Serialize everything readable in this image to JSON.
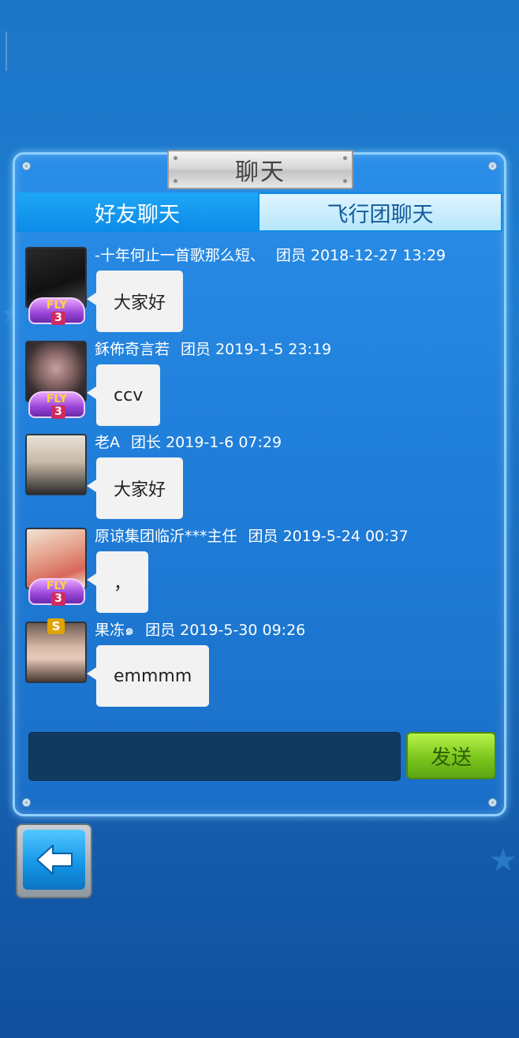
{
  "title": "聊天",
  "tabs": [
    {
      "label": "好友聊天",
      "active": false
    },
    {
      "label": "飞行团聊天",
      "active": true
    }
  ],
  "messages": [
    {
      "name": "-十年何止一首歌那么短、",
      "role": "团员",
      "time": "2018-12-27 13:29",
      "text": "大家好",
      "badge": "FLY",
      "badge_level": "3"
    },
    {
      "name": "鉌佈奇言若",
      "role": "团员",
      "time": "2019-1-5 23:19",
      "text": "ccv",
      "badge": "FLY",
      "badge_level": "3"
    },
    {
      "name": "老A",
      "role": "团长",
      "time": "2019-1-6 07:29",
      "text": "大家好",
      "badge": "",
      "badge_level": ""
    },
    {
      "name": "原谅集团临沂***主任",
      "role": "团员",
      "time": "2019-5-24 00:37",
      "text": "，",
      "badge": "FLY",
      "badge_level": "3"
    },
    {
      "name": "果冻๑",
      "role": "团员",
      "time": "2019-5-30 09:26",
      "text": "emmmm",
      "badge": "S",
      "badge_level": ""
    }
  ],
  "input": {
    "value": ""
  },
  "send_label": "发送",
  "colors": {
    "accent": "#1f7dd8",
    "send": "#7cc61d",
    "tab_active": "#b6e6fb"
  },
  "icons": {
    "back": "arrow-left-icon"
  }
}
